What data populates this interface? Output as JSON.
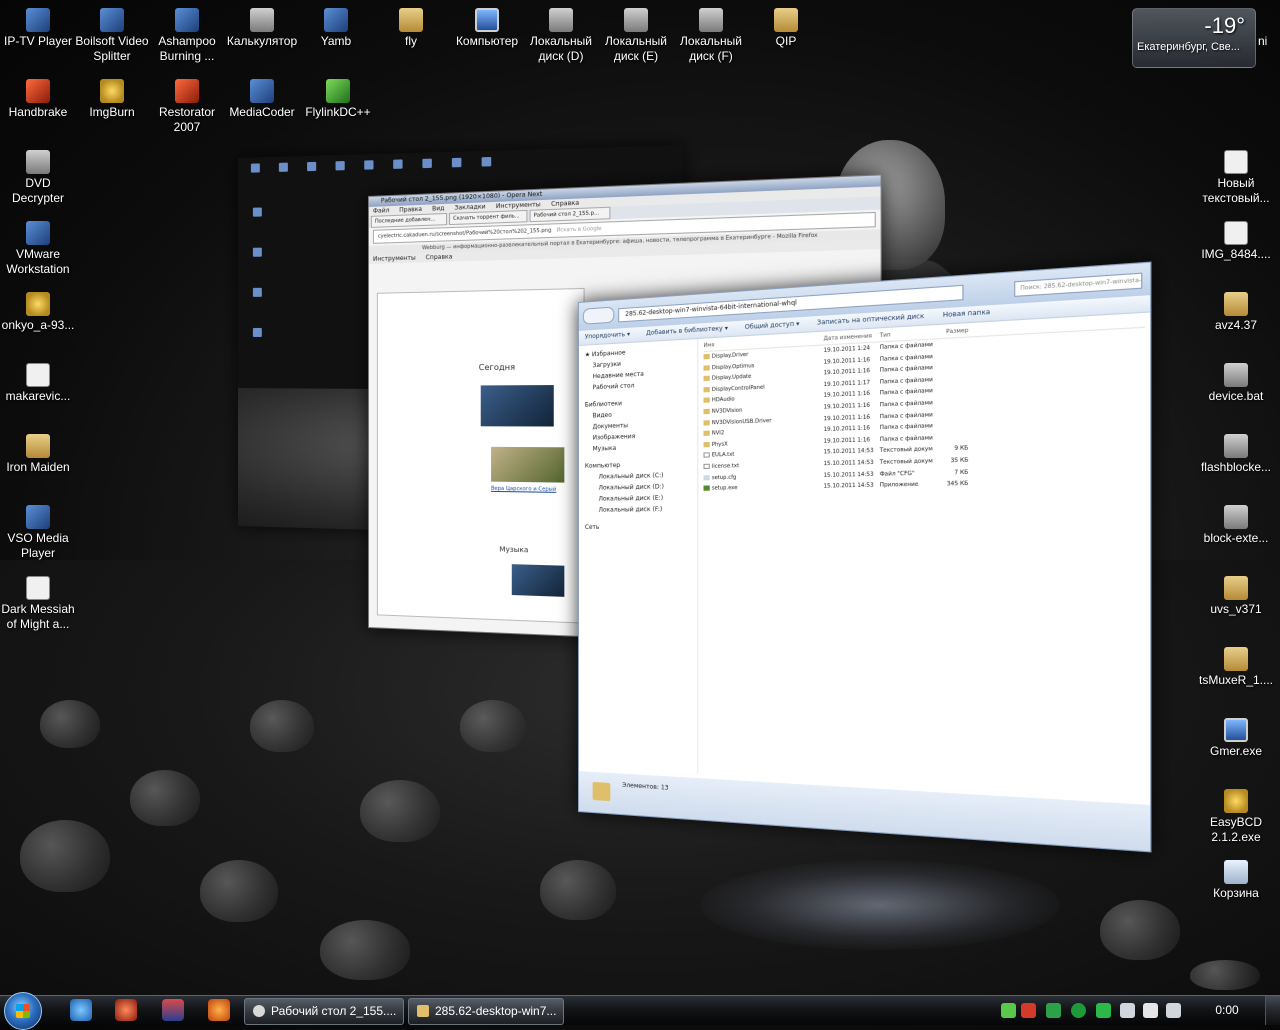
{
  "desktop": {
    "icons": [
      {
        "label": "IP-TV Player",
        "icon": "iptv-player-icon"
      },
      {
        "label": "Boilsoft Video Splitter",
        "icon": "video-splitter-icon"
      },
      {
        "label": "Ashampoo Burning ...",
        "icon": "ashampoo-icon"
      },
      {
        "label": "Калькулятор",
        "icon": "calculator-icon"
      },
      {
        "label": "Yamb",
        "icon": "yamb-icon"
      },
      {
        "label": "fly",
        "icon": "folder-icon"
      },
      {
        "label": "Компьютер",
        "icon": "computer-icon"
      },
      {
        "label": "Локальный диск (D)",
        "icon": "drive-icon"
      },
      {
        "label": "Локальный диск (E)",
        "icon": "drive-icon"
      },
      {
        "label": "Локальный диск (F)",
        "icon": "drive-icon"
      },
      {
        "label": "QIP",
        "icon": "folder-icon"
      },
      {
        "label": "Handbrake",
        "icon": "handbrake-icon"
      },
      {
        "label": "ImgBurn",
        "icon": "imgburn-icon"
      },
      {
        "label": "Restorator 2007",
        "icon": "restorator-icon"
      },
      {
        "label": "MediaCoder",
        "icon": "mediacoder-icon"
      },
      {
        "label": "FlylinkDC++",
        "icon": "flylink-icon"
      },
      {
        "label": "DVD Decrypter",
        "icon": "dvd-decrypter-icon"
      },
      {
        "label": "VMware Workstation",
        "icon": "vmware-icon"
      },
      {
        "label": "onkyo_a-93...",
        "icon": "file-icon"
      },
      {
        "label": "makarevic...",
        "icon": "document-icon"
      },
      {
        "label": "Iron Maiden",
        "icon": "folder-icon"
      },
      {
        "label": "VSO Media Player",
        "icon": "vso-player-icon"
      },
      {
        "label": "Dark Messiah of Might a...",
        "icon": "game-icon"
      },
      {
        "label": "Новый текстовый...",
        "icon": "text-file-icon"
      },
      {
        "label": "IMG_8484....",
        "icon": "image-file-icon"
      },
      {
        "label": "avz4.37",
        "icon": "folder-icon"
      },
      {
        "label": "device.bat",
        "icon": "batch-file-icon"
      },
      {
        "label": "flashblocke...",
        "icon": "batch-file-icon"
      },
      {
        "label": "block-exte...",
        "icon": "batch-file-icon"
      },
      {
        "label": "uvs_v371",
        "icon": "folder-icon"
      },
      {
        "label": "tsMuxeR_1....",
        "icon": "folder-icon"
      },
      {
        "label": "Gmer.exe",
        "icon": "gmer-icon"
      },
      {
        "label": "EasyBCD 2.1.2.exe",
        "icon": "easybcd-icon"
      },
      {
        "label": "Корзина",
        "icon": "recycle-bin-icon"
      }
    ]
  },
  "weather": {
    "temp": "-19°",
    "city": "Екатеринбург, Све...",
    "extra": "ni"
  },
  "windows": {
    "browser": {
      "title": "Рабочий стол 2_155.png (1920×1080) - Opera Next",
      "menu": [
        "Файл",
        "Правка",
        "Вид",
        "Закладки",
        "Инструменты",
        "Справка"
      ],
      "tabs": [
        "Последние добавлен...",
        "Скачать торрент филь...",
        "Рабочий стол 2_155.p..."
      ],
      "url": "cyelectric.cakaduen.ru/screenshot/Рабочий%20стол%202_155.png",
      "search": "Искать в Google",
      "inner_title": "Webburg — информационно-развлекательный портал в Екатеринбурге: афиша, новости, телепрограмма в Екатеринбурге - Mozilla Firefox",
      "inner_menu": [
        "Инструменты",
        "Справка"
      ],
      "page_heading1": "Сегодня",
      "page_heading2": "Музыка",
      "page_link": "Вера Царского и Серый"
    },
    "explorer": {
      "address": "285.62-desktop-win7-winvista-64bit-international-whql",
      "search": "Поиск: 285.62-desktop-win7-winvista-64bit...",
      "commands": [
        "Упорядочить ▾",
        "Добавить в библиотеку ▾",
        "Общий доступ ▾",
        "Записать на оптический диск",
        "Новая папка"
      ],
      "nav": [
        {
          "label": "Избранное",
          "level": 0
        },
        {
          "label": "Загрузки",
          "level": 1
        },
        {
          "label": "Недавние места",
          "level": 1
        },
        {
          "label": "Рабочий стол",
          "level": 1
        },
        {
          "label": "Библиотеки",
          "level": 0
        },
        {
          "label": "Видео",
          "level": 1
        },
        {
          "label": "Документы",
          "level": 1
        },
        {
          "label": "Изображения",
          "level": 1
        },
        {
          "label": "Музыка",
          "level": 1
        },
        {
          "label": "Компьютер",
          "level": 0
        },
        {
          "label": "Локальный диск (C:)",
          "level": 2
        },
        {
          "label": "Локальный диск (D:)",
          "level": 2
        },
        {
          "label": "Локальный диск (E:)",
          "level": 2
        },
        {
          "label": "Локальный диск (F:)",
          "level": 2
        },
        {
          "label": "Сеть",
          "level": 0
        }
      ],
      "columns": [
        "Имя",
        "Дата изменения",
        "Тип",
        "Размер"
      ],
      "files": [
        {
          "name": "Display.Driver",
          "date": "19.10.2011 1:24",
          "type": "Папка с файлами",
          "size": "",
          "kind": "folder"
        },
        {
          "name": "Display.Optimus",
          "date": "19.10.2011 1:16",
          "type": "Папка с файлами",
          "size": "",
          "kind": "folder"
        },
        {
          "name": "Display.Update",
          "date": "19.10.2011 1:16",
          "type": "Папка с файлами",
          "size": "",
          "kind": "folder"
        },
        {
          "name": "DisplayControlPanel",
          "date": "19.10.2011 1:17",
          "type": "Папка с файлами",
          "size": "",
          "kind": "folder"
        },
        {
          "name": "HDAudio",
          "date": "19.10.2011 1:16",
          "type": "Папка с файлами",
          "size": "",
          "kind": "folder"
        },
        {
          "name": "NV3DVision",
          "date": "19.10.2011 1:16",
          "type": "Папка с файлами",
          "size": "",
          "kind": "folder"
        },
        {
          "name": "NV3DVisionUSB.Driver",
          "date": "19.10.2011 1:16",
          "type": "Папка с файлами",
          "size": "",
          "kind": "folder"
        },
        {
          "name": "NVI2",
          "date": "19.10.2011 1:16",
          "type": "Папка с файлами",
          "size": "",
          "kind": "folder"
        },
        {
          "name": "PhysX",
          "date": "19.10.2011 1:16",
          "type": "Папка с файлами",
          "size": "",
          "kind": "folder"
        },
        {
          "name": "EULA.txt",
          "date": "15.10.2011 14:53",
          "type": "Текстовый докум...",
          "size": "9 КБ",
          "kind": "doc"
        },
        {
          "name": "license.txt",
          "date": "15.10.2011 14:53",
          "type": "Текстовый докум...",
          "size": "35 КБ",
          "kind": "doc"
        },
        {
          "name": "setup.cfg",
          "date": "15.10.2011 14:53",
          "type": "Файл \"CFG\"",
          "size": "7 КБ",
          "kind": "cfg"
        },
        {
          "name": "setup.exe",
          "date": "15.10.2011 14:53",
          "type": "Приложение",
          "size": "345 КБ",
          "kind": "exe"
        }
      ],
      "status": "Элементов: 13"
    }
  },
  "taskbar": {
    "buttons": [
      {
        "label": "Рабочий стол 2_155...."
      },
      {
        "label": "285.62-desktop-win7..."
      }
    ],
    "clock": "0:00"
  }
}
